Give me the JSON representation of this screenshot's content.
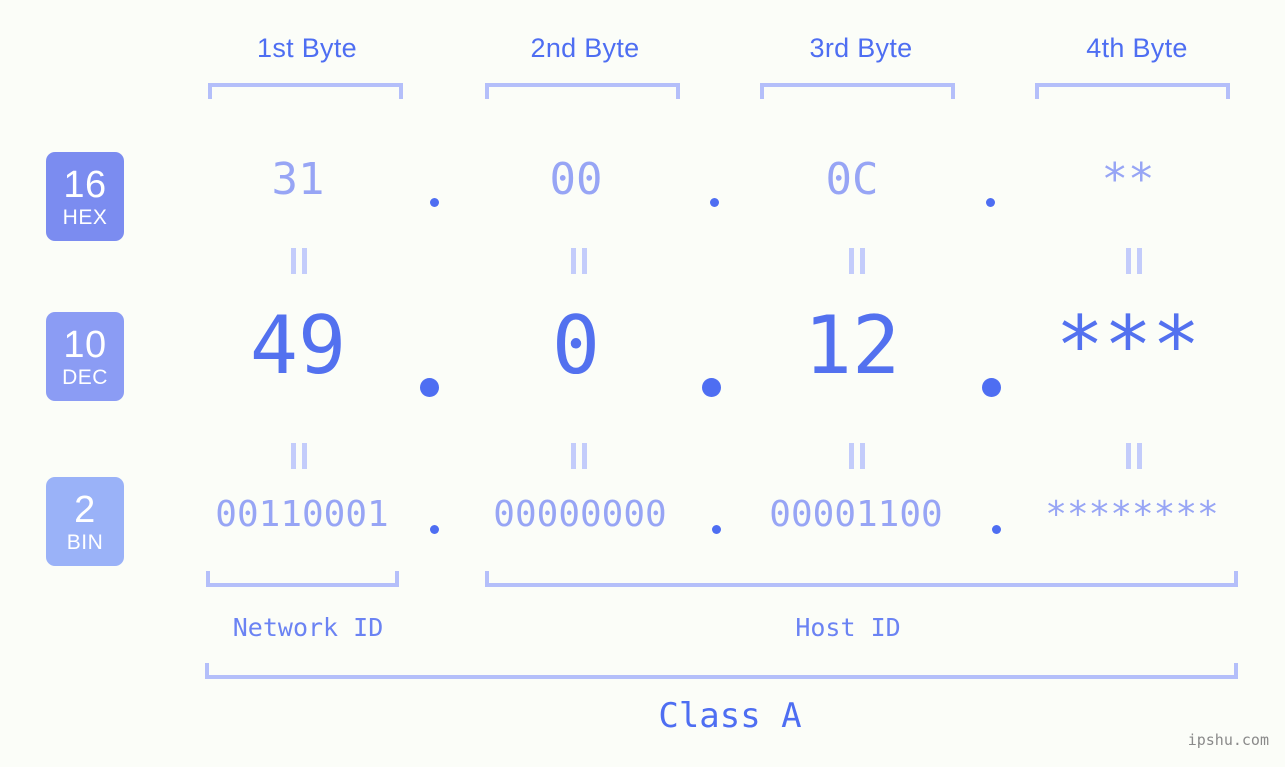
{
  "background_color": "#fbfdf8",
  "accent_color": "#4e6ef2",
  "muted_accent_color": "#97a5f5",
  "bracket_color": "#b4bffa",
  "byte_headers": [
    {
      "label": "1st Byte"
    },
    {
      "label": "2nd Byte"
    },
    {
      "label": "3rd Byte"
    },
    {
      "label": "4th Byte"
    }
  ],
  "radix_badges": [
    {
      "number": "16",
      "name": "HEX",
      "color": "#7b8cf0"
    },
    {
      "number": "10",
      "name": "DEC",
      "color": "#8b9cf4"
    },
    {
      "number": "2",
      "name": "BIN",
      "color": "#9ab2f8"
    }
  ],
  "rows": {
    "hex": {
      "radix_number": "16",
      "radix_name": "HEX",
      "octets": [
        "31",
        "00",
        "0C",
        "**"
      ],
      "separators": [
        ".",
        ".",
        "."
      ]
    },
    "dec": {
      "radix_number": "10",
      "radix_name": "DEC",
      "octets": [
        "49",
        "0",
        "12",
        "***"
      ],
      "separators": [
        ".",
        ".",
        "."
      ]
    },
    "bin": {
      "radix_number": "2",
      "radix_name": "BIN",
      "octets": [
        "00110001",
        "00000000",
        "00001100",
        "********"
      ],
      "separators": [
        ".",
        ".",
        "."
      ]
    }
  },
  "equality_marks": {
    "glyph": "=",
    "count_per_row": 4,
    "rows": 2
  },
  "id_labels": [
    {
      "label": "Network ID",
      "span": "1st Byte"
    },
    {
      "label": "Host ID",
      "span": "2nd-4th Byte"
    }
  ],
  "class_label": "Class A",
  "watermark": "ipshu.com"
}
